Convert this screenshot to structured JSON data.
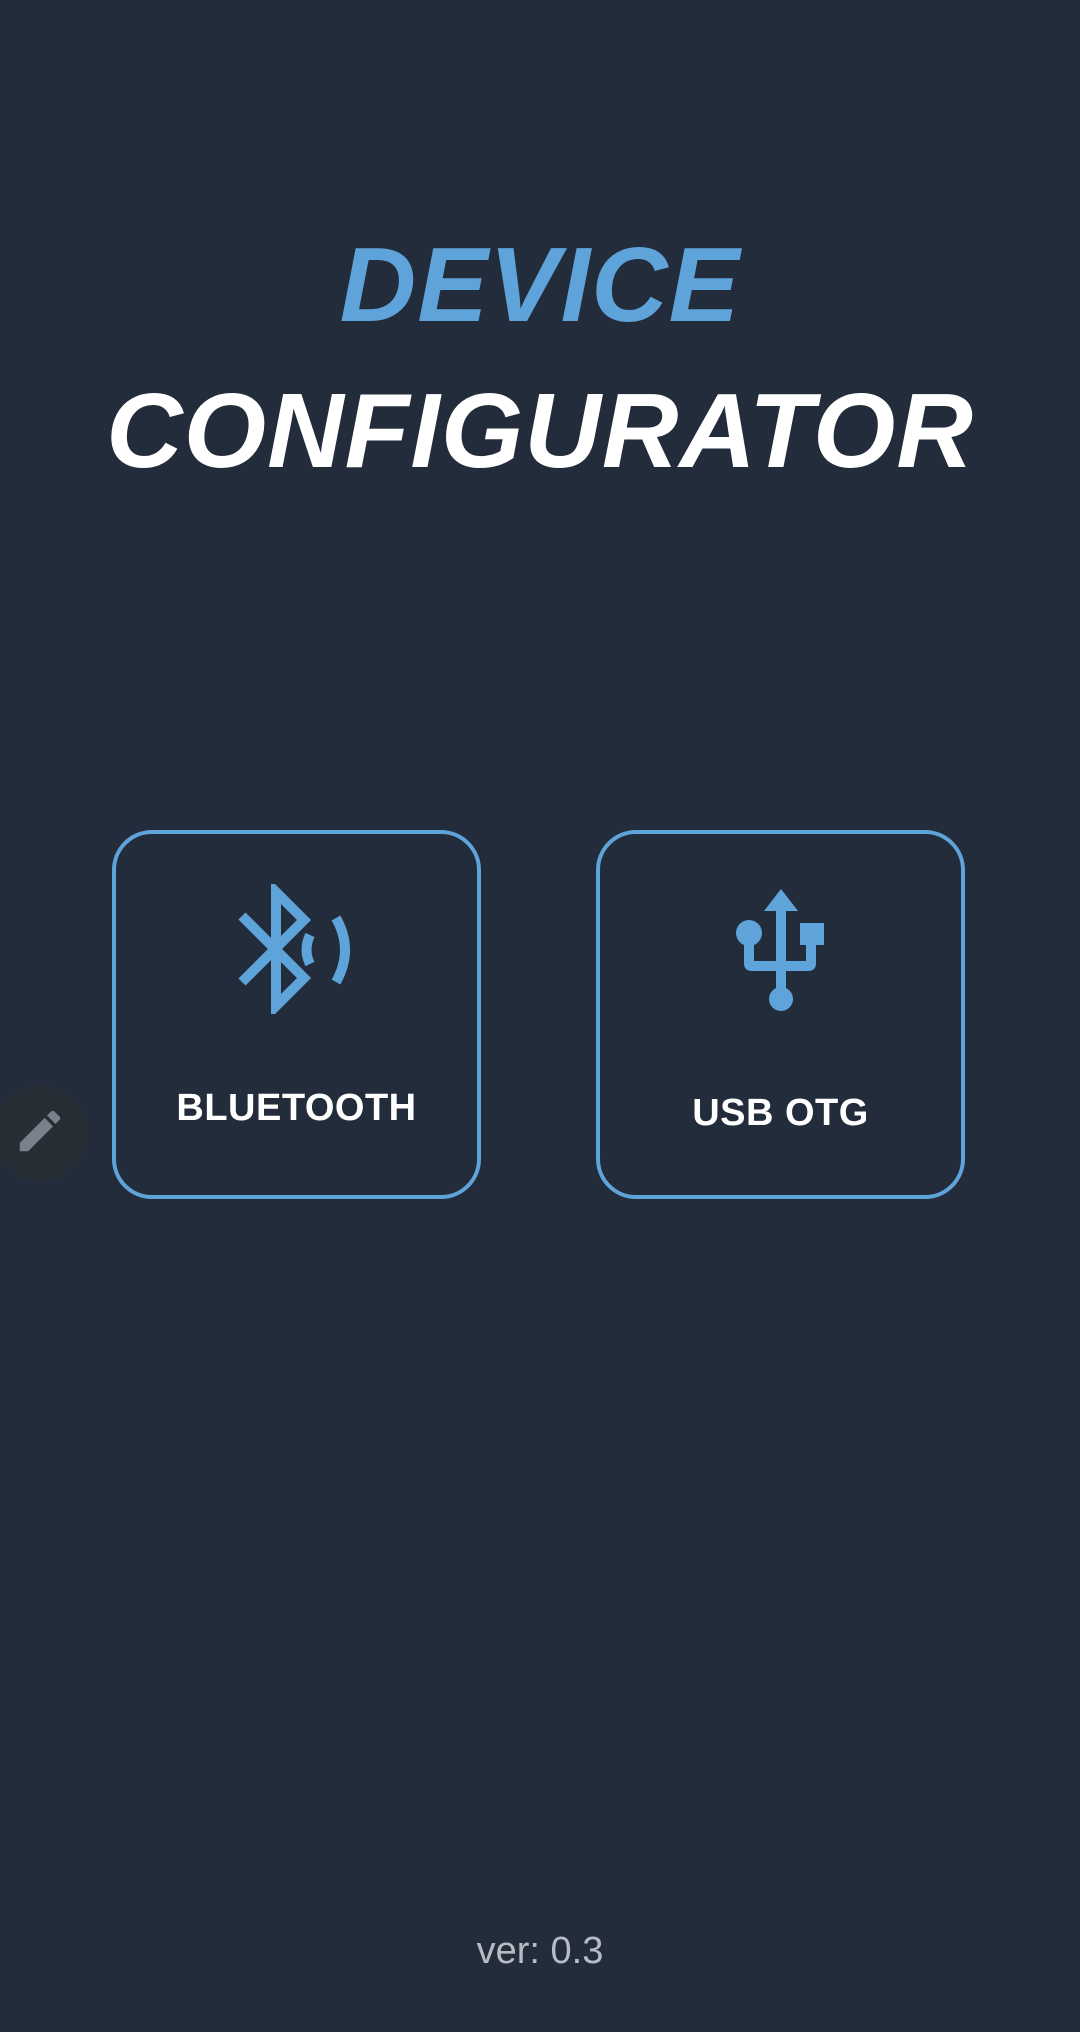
{
  "app": {
    "title_line1": "DEVICE",
    "title_line2": "CONFIGURATOR"
  },
  "connections": [
    {
      "label": "BLUETOOTH",
      "icon": "bluetooth-searching-icon"
    },
    {
      "label": "USB OTG",
      "icon": "usb-icon"
    }
  ],
  "edit_button": {
    "icon": "pencil-icon"
  },
  "footer": {
    "version": "ver: 0.3"
  },
  "colors": {
    "background": "#232c3a",
    "accent": "#5ea3d9",
    "title_secondary": "#ffffff",
    "version_text": "#b7bcc4",
    "fab_background": "#272d35"
  }
}
